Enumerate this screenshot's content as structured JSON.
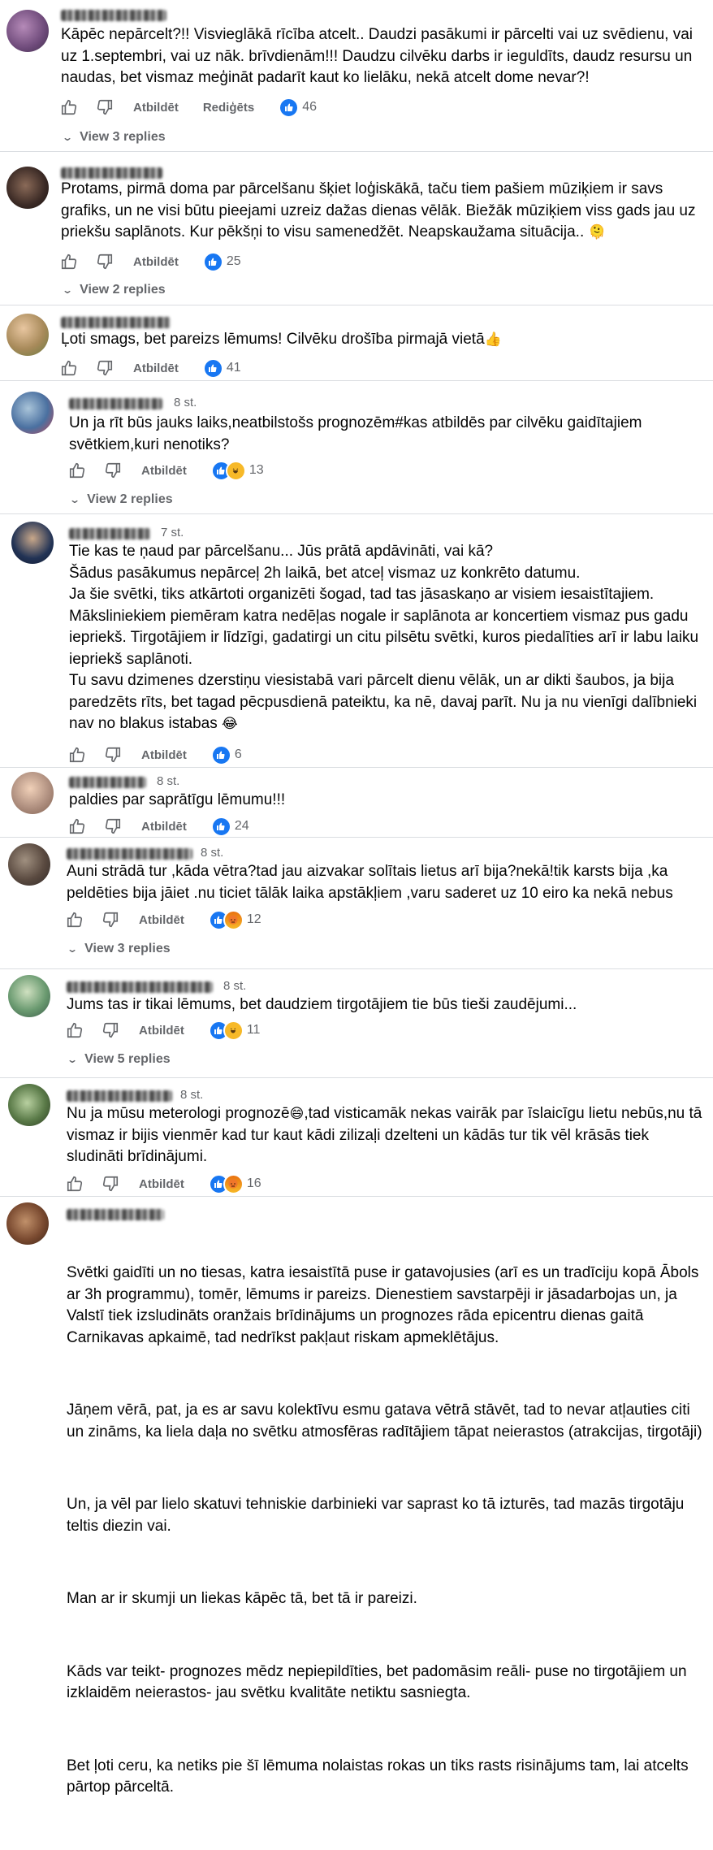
{
  "ui": {
    "like_label": "Atbildēt",
    "edited_label": "Rediģēts"
  },
  "comments": [
    {
      "text": "Kāpēc nepārcelt?!! Visvieglākā rīcība atcelt.. Daudzi pasākumi ir pārcelti vai uz svēdienu, vai uz 1.septembri, vai uz nāk. brīvdienām!!! Daudzu cilvēku darbs ir ieguldīts, daudz resursu un naudas, bet vismaz meģināt padarīt kaut ko lielāku, nekā atcelt dome nevar?!",
      "reply": "Atbildēt",
      "edited": "Rediģēts",
      "reaction_count": "46",
      "view_replies": "View 3 replies"
    },
    {
      "text": "Protams, pirmā doma par pārcelšanu šķiet loģiskākā, taču tiem pašiem mūziķiem ir savs grafiks, un ne visi būtu pieejami uzreiz dažas dienas vēlāk. Biežāk mūziķiem viss gads jau uz priekšu saplānots. Kur pēkšņi to visu samenedžēt. Neapskaužama situācija..",
      "emoji": "🫠",
      "reply": "Atbildēt",
      "reaction_count": "25",
      "view_replies": "View 2 replies"
    },
    {
      "text": "Ļoti smags, bet pareizs lēmums! Cilvēku drošība pirmajā vietā",
      "emoji": "👍",
      "reply": "Atbildēt",
      "reaction_count": "41"
    },
    {
      "time": "8 st.",
      "text": "Un ja rīt būs jauks laiks,neatbilstošs prognozēm#kas atbildēs par cilvēku gaidītajiem svētkiem,kuri nenotiks?",
      "reply": "Atbildēt",
      "reaction_count": "13",
      "view_replies": "View 2 replies"
    },
    {
      "time": "7 st.",
      "paragraphs": [
        "Tie kas te ņaud par pārcelšanu... Jūs prātā apdāvināti, vai kā?\nŠādus pasākumus nepārceļ 2h laikā, bet atceļ vismaz uz konkrēto datumu.\nJa šie svētki, tiks atkārtoti organizēti šogad, tad tas jāsaskaņo ar visiem iesaistītajiem.\nMāksliniekiem piemēram katra nedēļas nogale ir saplānota ar koncertiem vismaz pus gadu iepriekš. Tirgotājiem ir līdzīgi, gadatirgi un citu pilsētu svētki, kuros piedalīties arī ir labu laiku iepriekš saplānoti.\nTu savu dzimenes dzerstiņu viesistabā vari pārcelt dienu vēlāk, un ar dikti šaubos, ja bija paredzēts rīts, bet tagad pēcpusdienā pateiktu, ka nē, davaj parīt. Nu ja nu vienīgi dalībnieki nav no blakus istabas"
      ],
      "emoji": "😂",
      "reply": "Atbildēt",
      "reaction_count": "6"
    },
    {
      "time": "8 st.",
      "text": "paldies par saprātīgu lēmumu!!!",
      "reply": "Atbildēt",
      "reaction_count": "24"
    },
    {
      "time": "8 st.",
      "text": "Auni strādā tur ,kāda vētra?tad jau aizvakar solītais lietus arī bija?nekā!tik karsts bija ,ka peldēties bija jāiet .nu ticiet tālāk laika apstākļiem ,varu saderet uz 10 eiro ka nekā nebus",
      "reply": "Atbildēt",
      "reaction_count": "12",
      "view_replies": "View 3 replies"
    },
    {
      "time": "8 st.",
      "text": "Jums tas ir tikai lēmums, bet daudziem tirgotājiem tie būs tieši zaudējumi...",
      "reply": "Atbildēt",
      "reaction_count": "11",
      "view_replies": "View 5 replies"
    },
    {
      "time": "8 st.",
      "text_a": "Nu ja mūsu meterologi prognozē",
      "emoji": "😄",
      "text_b": ",tad visticamāk nekas vairāk par īslaicīgu lietu nebūs,nu tā vismaz ir bijis vienmēr kad tur kaut kādi zilizaļi dzelteni un kādās tur tik vēl krāsās tiek sludināti brīdinājumi.",
      "reply": "Atbildēt",
      "reaction_count": "16"
    },
    {
      "paragraphs": [
        "Svētki gaidīti un no tiesas, katra iesaistītā puse ir gatavojusies (arī es un tradīciju kopā Ābols ar 3h programmu), tomēr, lēmums ir pareizs. Dienestiem savstarpēji ir jāsadarbojas un, ja Valstī tiek izsludināts oranžais brīdinājums un prognozes rāda epicentru dienas gaitā Carnikavas apkaimē, tad nedrīkst pakļaut riskam apmeklētājus.",
        "Jāņem vērā, pat, ja es ar savu kolektīvu esmu gatava vētrā stāvēt, tad to nevar atļauties citi un zināms, ka liela daļa no svētku atmosfēras radītājiem tāpat neierastos (atrakcijas, tirgotāji)",
        "Un, ja vēl par lielo skatuvi tehniskie darbinieki var saprast ko tā izturēs, tad mazās tirgotāju teltis diezin vai.",
        "Man ar ir skumji un liekas kāpēc tā, bet tā ir pareizi.",
        "Kāds var teikt- prognozes mēdz nepiepildīties, bet padomāsim reāli- puse no tirgotājiem un izklaidēm neierastos- jau svētku kvalitāte netiktu sasniegta.",
        "Bet ļoti ceru, ka netiks pie šī lēmuma nolaistas rokas un tiks rasts risinājums tam, lai atcelts pārtop pārceltā."
      ]
    }
  ]
}
